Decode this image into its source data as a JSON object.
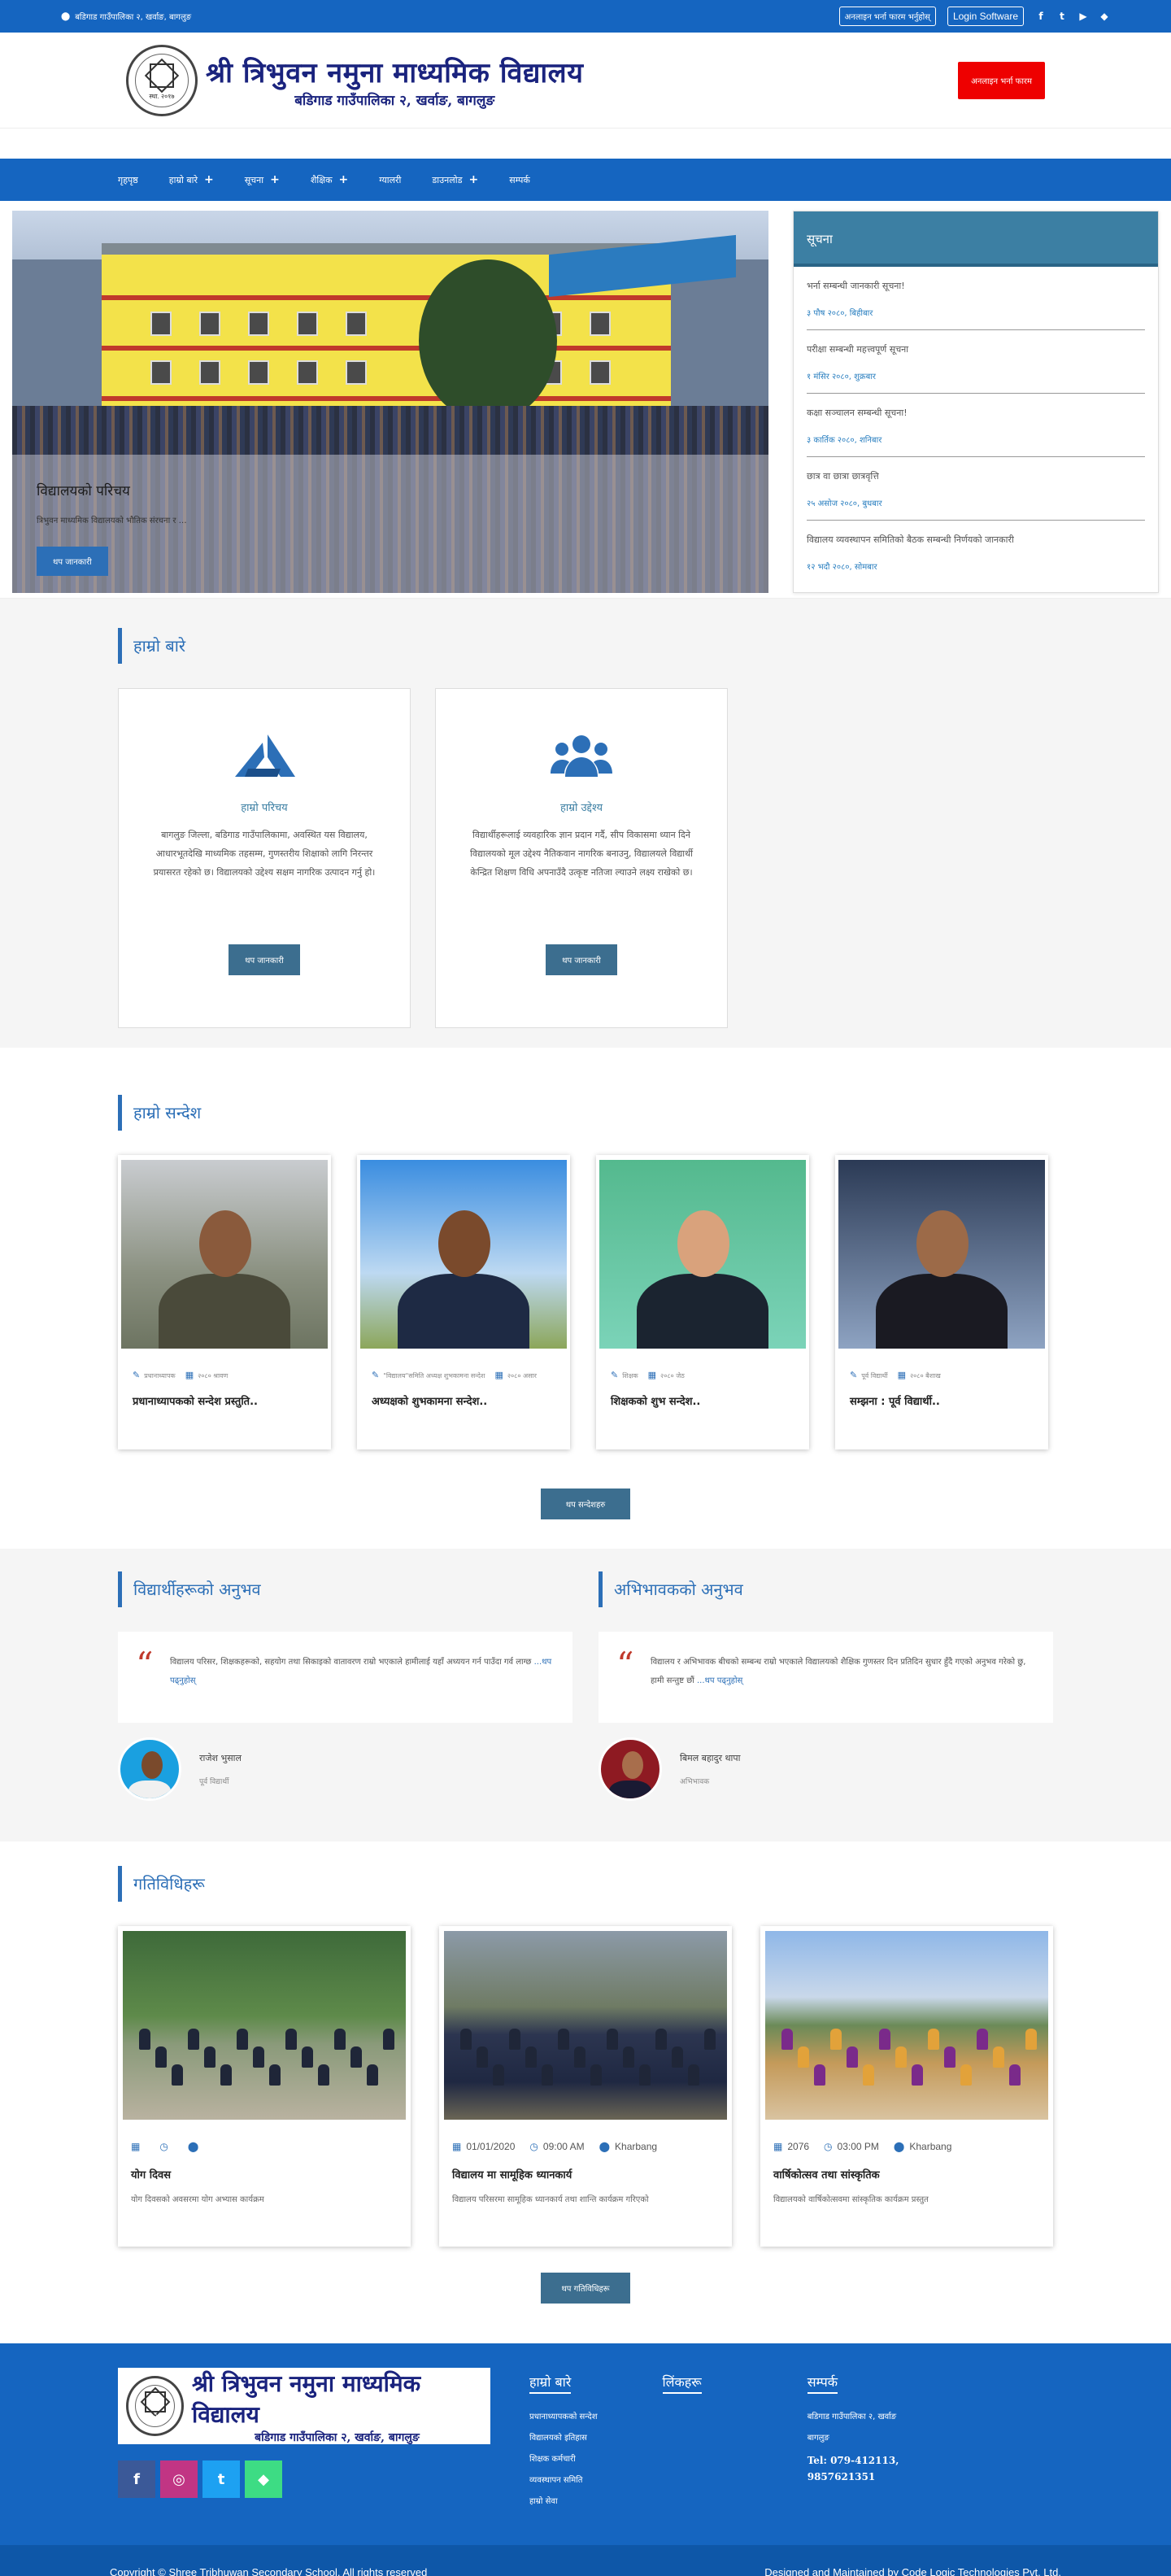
{
  "topbar": {
    "address": "बडिगाड गाउँपालिका २, खर्वाङ, बागलुङ",
    "online_apply": "अनलाइन भर्ना फारम भर्नुहोस्",
    "login": "Login Software",
    "social": [
      {
        "name": "facebook-icon",
        "glyph": "f"
      },
      {
        "name": "twitter-icon",
        "glyph": "t"
      },
      {
        "name": "youtube-icon",
        "glyph": "▶"
      },
      {
        "name": "android-icon",
        "glyph": "◆"
      }
    ]
  },
  "header": {
    "school_name": "श्री त्रिभुवन नमुना माध्यमिक विद्यालय",
    "location": "बडिगाड गाउँपालिका २, खर्वाङ, बागलुङ",
    "seal_text": "स्था. २०१७",
    "apply_button": "अनलाइन भर्ना फारम"
  },
  "nav": [
    {
      "label": "गृहपृष्ठ",
      "plus": false
    },
    {
      "label": "हाम्रो बारे",
      "plus": true
    },
    {
      "label": "सूचना",
      "plus": true
    },
    {
      "label": "शैक्षिक",
      "plus": true
    },
    {
      "label": "ग्यालरी",
      "plus": false
    },
    {
      "label": "डाउनलोड",
      "plus": true
    },
    {
      "label": "सम्पर्क",
      "plus": false
    }
  ],
  "slide": {
    "title": "विद्यालयको परिचय",
    "text": "त्रिभुवन माध्यमिक विद्यालयको भौतिक संरचना र …",
    "button": "थप जानकारी"
  },
  "notices": {
    "title": "सूचना",
    "items": [
      {
        "title": "भर्ना सम्बन्धी जानकारी सूचना!",
        "date": "३ पौष २०८०, बिहीबार"
      },
      {
        "title": "परीक्षा सम्बन्धी महत्त्वपूर्ण सूचना",
        "date": "१ मंसिर २०८०, शुक्रबार"
      },
      {
        "title": "कक्षा सञ्चालन सम्बन्धी सूचना!",
        "date": "३ कार्तिक २०८०, शनिबार"
      },
      {
        "title": "छात्र वा छात्रा छात्रवृत्ति",
        "date": "२५ असोज २०८०, बुधबार"
      },
      {
        "title": "विद्यालय व्यवस्थापन समितिको बैठक सम्बन्धी निर्णयको जानकारी",
        "date": "१२ भदौ २०८०, सोमबार"
      }
    ]
  },
  "intro": {
    "heading": "हाम्रो बारे",
    "cards": [
      {
        "icon": "logo-mark-icon",
        "title": "हाम्रो परिचय",
        "text": "बागलुङ जिल्ला, बडिगाड गाउँपालिकामा, अवस्थित यस विद्यालय, आधारभूतदेखि माध्यमिक तहसम्म, गुणस्तरीय शिक्षाको लागि निरन्तर प्रयासरत रहेको छ। विद्यालयको उद्देश्य सक्षम नागरिक उत्पादन गर्नु हो।",
        "button": "थप जानकारी"
      },
      {
        "icon": "users-icon",
        "title": "हाम्रो उद्देश्य",
        "text": "विद्यार्थीहरूलाई व्यवहारिक ज्ञान प्रदान गर्दै, सीप विकासमा ध्यान दिने विद्यालयको मूल उद्देश्य नैतिकवान नागरिक बनाउनु, विद्यालयले विद्यार्थी केन्द्रित शिक्षण विधि अपनाउँदै उत्कृष्ट नतिजा ल्याउने लक्ष्य राखेको छ।",
        "button": "थप जानकारी"
      }
    ]
  },
  "messages": {
    "heading": "हाम्रो सन्देश",
    "more": "थप सन्देशहरु",
    "cards": [
      {
        "author": "प्रधानाध्यापक",
        "date": "२०८० श्रावण",
        "title": "प्रधानाध्यापकको सन्देश प्रस्तुति..",
        "bg": "mount"
      },
      {
        "author": "\"विद्यालय\"समिति अध्यक्ष शुभकामना सन्देश",
        "date": "२०८० असार",
        "title": "अध्यक्षको शुभकामना सन्देश..",
        "bg": "sky"
      },
      {
        "author": "शिक्षक",
        "date": "२०८० जेठ",
        "title": "शिक्षकको शुभ सन्देश..",
        "bg": "green"
      },
      {
        "author": "पूर्व विद्यार्थी",
        "date": "२०८० बैशाख",
        "title": "सम्झना : पूर्व विद्यार्थी..",
        "bg": "dark"
      }
    ]
  },
  "testimonials": [
    {
      "heading": "विद्यार्थीहरूको अनुभव",
      "text": "विद्यालय परिसर, शिक्षकहरूको, सहयोग तथा सिकाइको वातावरण राम्रो भएकाले हामीलाई यहाँ अध्ययन गर्न पाउँदा गर्व लाग्छ",
      "more": "...थप पढ्नुहोस्",
      "name": "राजेश भुसाल",
      "role": "पूर्व विद्यार्थी"
    },
    {
      "heading": "अभिभावकको अनुभव",
      "text": "विद्यालय र अभिभावक बीचको सम्बन्ध राम्रो भएकाले विद्यालयको शैक्षिक गुणस्तर दिन प्रतिदिन सुधार हुँदै गएको अनुभव गरेको छु, हामी सन्तुष्ट छौं",
      "more": "...थप पढ्नुहोस्",
      "name": "बिमल बहादुर थापा",
      "role": "अभिभावक"
    }
  ],
  "activities": {
    "heading": "गतिविधिहरू",
    "more": "थप गतिविधिहरू",
    "cards": [
      {
        "date": "",
        "time": "",
        "place": "",
        "title": "योग दिवस",
        "text": "योग दिवसको अवसरमा योग अभ्यास कार्यक्रम"
      },
      {
        "date": "01/01/2020",
        "time": "09:00 AM",
        "place": "Kharbang",
        "title": "विद्यालय मा सामूहिक ध्यानकार्य",
        "text": "विद्यालय परिसरमा सामूहिक ध्यानकार्य तथा शान्ति कार्यक्रम गरिएको"
      },
      {
        "date": "2076",
        "time": "03:00 PM",
        "place": "Kharbang",
        "title": "वार्षिकोत्सव तथा सांस्कृतिक",
        "text": "विद्यालयको वार्षिकोत्सवमा सांस्कृतिक कार्यक्रम प्रस्तुत"
      }
    ]
  },
  "footer": {
    "school_name": "श्री त्रिभुवन नमुना माध्यमिक विद्यालय",
    "location": "बडिगाड गाउँपालिका २, खर्वाङ, बागलुङ",
    "seal_text": "स्था. २०१७",
    "social": [
      {
        "name": "facebook-icon",
        "glyph": "f",
        "color": "#3b5998"
      },
      {
        "name": "instagram-icon",
        "glyph": "◎",
        "color": "#c13584"
      },
      {
        "name": "twitter-icon",
        "glyph": "t",
        "color": "#1da1f2"
      },
      {
        "name": "android-icon",
        "glyph": "◆",
        "color": "#3ddc84"
      }
    ],
    "col1": {
      "heading": "हाम्रो बारे",
      "links": [
        "प्रधानाध्यापकको सन्देश",
        "विद्यालयको इतिहास",
        "शिक्षक कर्मचारी",
        "व्यवस्थापन समिति",
        "हाम्रो सेवा"
      ]
    },
    "col2": {
      "heading": "लिंकहरू",
      "links": []
    },
    "col3": {
      "heading": "सम्पर्क",
      "address": "बडिगाड गाउँपालिका २, खर्वाङ",
      "district": "बागलुङ",
      "tel": "Tel: 079-412113,",
      "tel2": "9857621351"
    }
  },
  "copyright": {
    "left": "Copyright © Shree Tribhuwan Secondary School. All rights reserved",
    "right": "Designed and Maintained by Code Logic Technologies Pvt. Ltd."
  },
  "colors": {
    "primary": "#1565c0",
    "accent": "#2c6fb7",
    "apply": "#ee0000"
  }
}
